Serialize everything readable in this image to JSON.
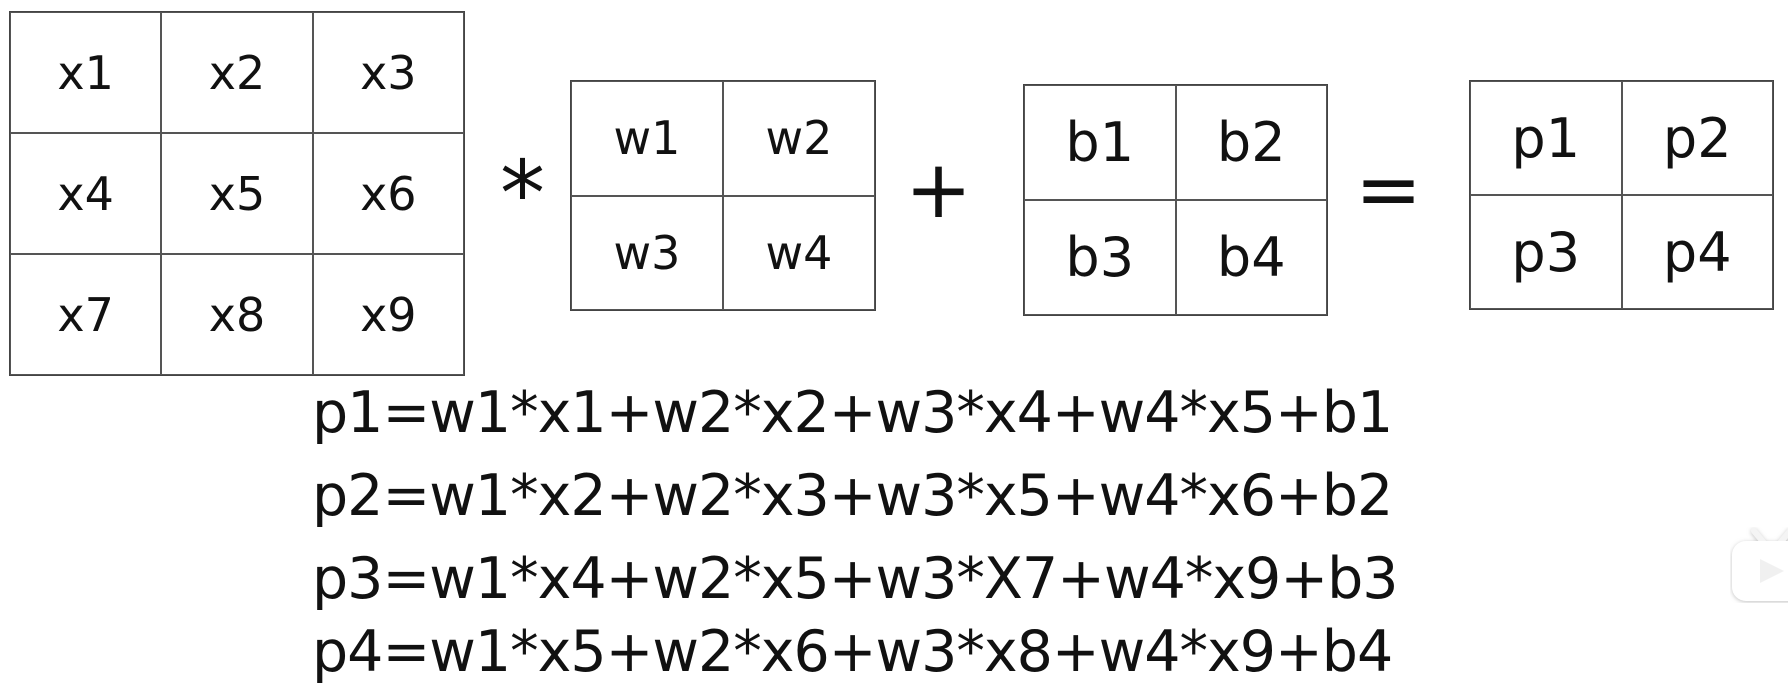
{
  "input_matrix": [
    "x1",
    "x2",
    "x3",
    "x4",
    "x5",
    "x6",
    "x7",
    "x8",
    "x9"
  ],
  "weight_matrix": [
    "w1",
    "w2",
    "w3",
    "w4"
  ],
  "bias_matrix": [
    "b1",
    "b2",
    "b3",
    "b4"
  ],
  "output_matrix": [
    "p1",
    "p2",
    "p3",
    "p4"
  ],
  "operators": {
    "multiply": "*",
    "add": "+",
    "equals": "="
  },
  "equations": [
    "p1=w1*x1+w2*x2+w3*x4+w4*x5+b1",
    "p2=w1*x2+w2*x3+w3*x5+w4*x6+b2",
    "p3=w1*x4+w2*x5+w3*X7+w4*x9+b3",
    "p4=w1*x5+w2*x6+w3*x8+w4*x9+b4"
  ],
  "watermark_icon": "tv-play-icon"
}
